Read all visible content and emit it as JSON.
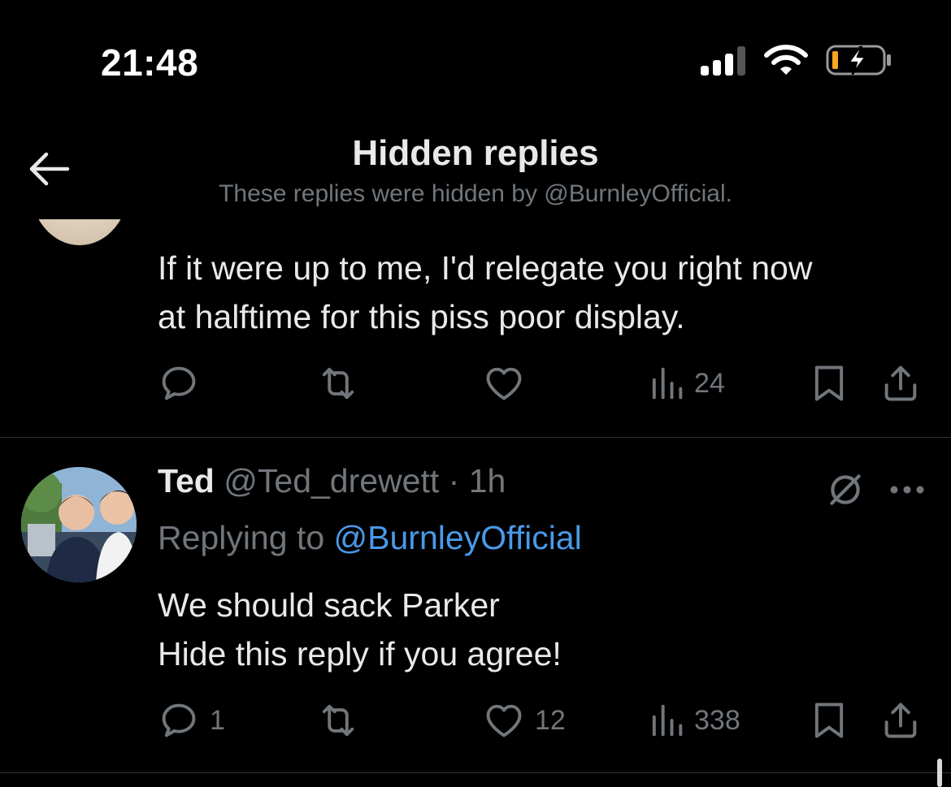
{
  "status_bar": {
    "time": "21:48",
    "icons": [
      "cellular-signal-icon",
      "wifi-icon",
      "battery-charging-icon"
    ]
  },
  "header": {
    "title": "Hidden replies",
    "subtitle": "These replies were hidden by @BurnleyOfficial.",
    "back_icon": "arrow-left-icon"
  },
  "tweets": [
    {
      "text_lines": [
        "If it were up to me, I'd relegate you right now",
        "at halftime for this piss poor display."
      ],
      "actions": {
        "reply_count": "",
        "retweet_count": "",
        "like_count": "",
        "views_count": "24"
      }
    },
    {
      "name": "Ted",
      "handle": "@Ted_drewett",
      "separator": "·",
      "time": "1h",
      "replying_prefix": "Replying to ",
      "replying_to": "@BurnleyOfficial",
      "text_lines": [
        "We should sack Parker",
        "Hide this reply if you agree!"
      ],
      "actions": {
        "reply_count": "1",
        "retweet_count": "",
        "like_count": "12",
        "views_count": "338"
      }
    }
  ],
  "colors": {
    "background": "#000000",
    "text": "#e7e9ea",
    "muted": "#71767b",
    "link": "#4a99e9",
    "divider": "#2f3336"
  }
}
